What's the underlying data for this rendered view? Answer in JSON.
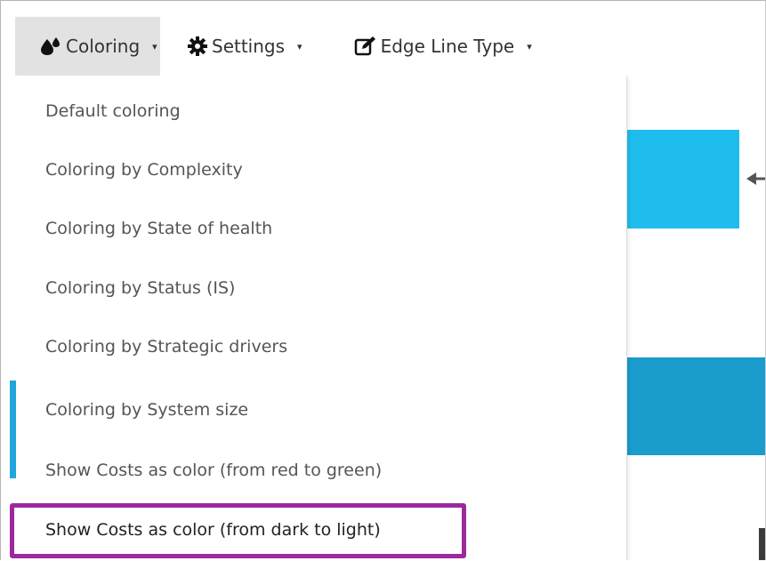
{
  "toolbar": {
    "coloring": {
      "label": "Coloring",
      "icon": "drops-icon"
    },
    "settings": {
      "label": "Settings",
      "icon": "gear-icon"
    },
    "edge_line_type": {
      "label": "Edge Line Type",
      "icon": "edit-icon"
    },
    "caret": "▾"
  },
  "menu": {
    "items": [
      {
        "label": "Default coloring"
      },
      {
        "label": "Coloring by Complexity"
      },
      {
        "label": "Coloring by State of health"
      },
      {
        "label": "Coloring by Status (IS)"
      },
      {
        "label": "Coloring by Strategic drivers"
      },
      {
        "label": "Coloring by System size"
      },
      {
        "label": "Show Costs as color (from red to green)"
      },
      {
        "label": "Show Costs as color (from dark to light)"
      }
    ],
    "highlighted_index": 7
  },
  "colors": {
    "highlight_border": "#9b2a9d",
    "node_light_blue": "#1fbcee",
    "node_blue": "#1a9ccd",
    "toolbar_active_bg": "#e2e2e2"
  }
}
